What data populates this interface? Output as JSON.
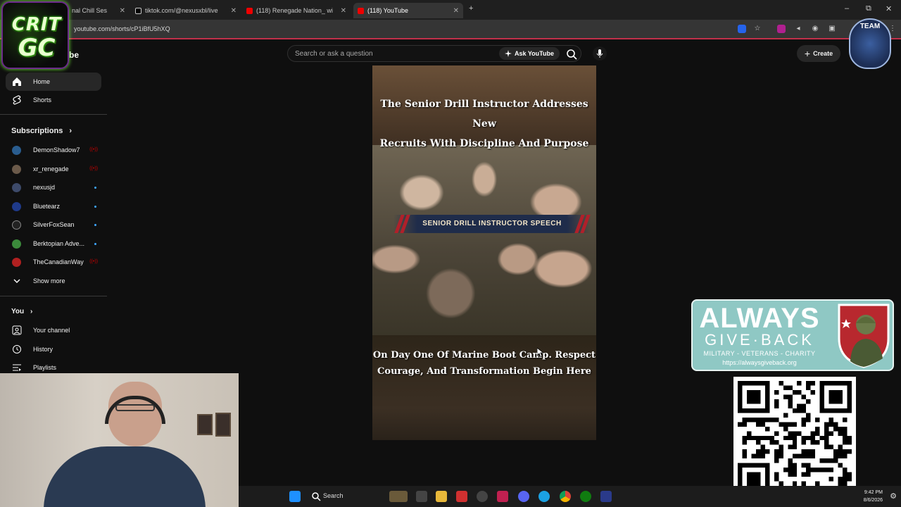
{
  "browser": {
    "tabs": [
      {
        "label": "nal Chill Ses",
        "active": false
      },
      {
        "label": "tiktok.com/@nexusxbl/live",
        "active": false
      },
      {
        "label": "(118) Renegade Nation_ wi",
        "active": false
      },
      {
        "label": "(118) YouTube",
        "active": true
      }
    ],
    "new_tab": "+",
    "url": "youtube.com/shorts/cP1iBfU5hXQ",
    "window_controls": {
      "minimize": "–",
      "restore": "⧉",
      "close": "✕"
    }
  },
  "overlay_logo": {
    "line1": "CRIT",
    "line2": "GC"
  },
  "team_badge": {
    "text": "TEAM"
  },
  "header": {
    "brand_fragment": "be",
    "search_placeholder": "Search or ask a question",
    "ask_label": "Ask YouTube",
    "create_label": "Create"
  },
  "sidebar": {
    "main": [
      {
        "label": "Home",
        "icon": "home-icon",
        "active": true
      },
      {
        "label": "Shorts",
        "icon": "shorts-icon",
        "active": false
      }
    ],
    "subscriptions_heading": "Subscriptions",
    "subscriptions": [
      {
        "name": "DemonShadow7",
        "status": "live",
        "color": "#2a5d8f"
      },
      {
        "name": "xr_renegade",
        "status": "live",
        "color": "#6b5a4a"
      },
      {
        "name": "nexusjd",
        "status": "new",
        "color": "#3d4a6a"
      },
      {
        "name": "Bluetearz",
        "status": "new",
        "color": "#1f3a8a"
      },
      {
        "name": "SilverFoxSean",
        "status": "new",
        "color": "#222222"
      },
      {
        "name": "Berktopian Adve...",
        "status": "new",
        "color": "#3b8a3b"
      },
      {
        "name": "TheCanadianWay",
        "status": "live",
        "color": "#b02020"
      }
    ],
    "show_more": "Show more",
    "you_heading": "You",
    "you_items": [
      {
        "label": "Your channel",
        "icon": "channel-icon"
      },
      {
        "label": "History",
        "icon": "history-icon"
      },
      {
        "label": "Playlists",
        "icon": "playlists-icon"
      }
    ]
  },
  "video": {
    "title_line1": "The Senior Drill Instructor Addresses New",
    "title_line2": "Recruits With Discipline And Purpose",
    "banner": "SENIOR DRILL INSTRUCTOR SPEECH",
    "caption_line1": "On Day One Of Marine Boot Camp. Respect",
    "caption_line2": "Courage, And Transformation Begin Here"
  },
  "agb": {
    "line1": "ALWAYS",
    "line2": "GIVE·BACK",
    "line3": "MILITARY - VETERANS - CHARITY",
    "url": "https://alwaysgiveback.org"
  },
  "taskbar": {
    "search_label": "Search",
    "time": "9:42 PM",
    "date": "8/6/2026"
  },
  "colors": {
    "yt_bg": "#0f0f0f",
    "accent_red": "#c0304a",
    "agb_teal": "#8fc8c4",
    "crit_green": "#39ff14"
  }
}
